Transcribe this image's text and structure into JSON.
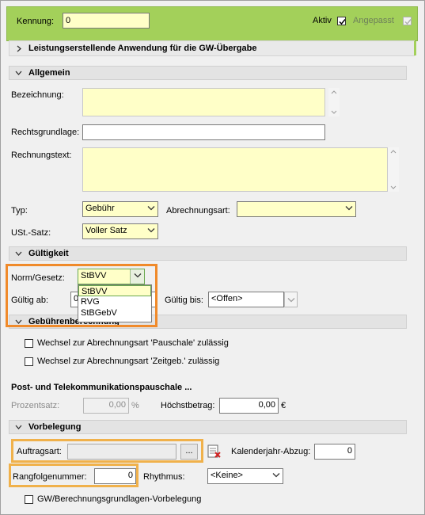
{
  "header": {
    "kennung_label": "Kennung:",
    "kennung_value": "0",
    "aktiv_label": "Aktiv",
    "angepasst_label": "Angepasst",
    "group_title": "Leistungserstellende Anwendung für die GW-Übergabe"
  },
  "allgemein": {
    "title": "Allgemein",
    "bezeichnung_label": "Bezeichnung:",
    "bezeichnung_value": "",
    "rechtsgrundlage_label": "Rechtsgrundlage:",
    "rechtsgrundlage_value": "",
    "rechnungstext_label": "Rechnungstext:",
    "rechnungstext_value": "",
    "typ_label": "Typ:",
    "typ_value": "Gebühr",
    "abrechnungsart_label": "Abrechnungsart:",
    "abrechnungsart_value": "",
    "ust_label": "USt.-Satz:",
    "ust_value": "Voller Satz"
  },
  "gueltigkeit": {
    "title": "Gültigkeit",
    "norm_label": "Norm/Gesetz:",
    "norm_value": "StBVV",
    "norm_options": [
      "StBVV",
      "RVG",
      "StBGebV"
    ],
    "gueltig_ab_label": "Gültig ab:",
    "gueltig_ab_value": "0",
    "gueltig_bis_label": "Gültig bis:",
    "gueltig_bis_value": "<Offen>"
  },
  "gebuehren": {
    "title": "Gebührenberechnung",
    "chk_pauschale": "Wechsel zur Abrechnungsart 'Pauschale' zulässig",
    "chk_zeitgeb": "Wechsel zur Abrechnungsart 'Zeitgeb.' zulässig"
  },
  "post": {
    "title": "Post- und Telekommunikationspauschale ...",
    "prozentsatz_label": "Prozentsatz:",
    "prozentsatz_value": "0,00",
    "prozent_unit": "%",
    "hoechst_label": "Höchstbetrag:",
    "hoechst_value": "0,00",
    "currency": "€"
  },
  "vorbelegung": {
    "title": "Vorbelegung",
    "auftragsart_label": "Auftragsart:",
    "auftragsart_value": "",
    "browse_label": "...",
    "kalender_label": "Kalenderjahr-Abzug:",
    "kalender_value": "0",
    "rang_label": "Rangfolgenummer:",
    "rang_value": "0",
    "rhythmus_label": "Rhythmus:",
    "rhythmus_value": "<Keine>",
    "chk_gw": "GW/Berechnungsgrundlagen-Vorbelegung"
  }
}
